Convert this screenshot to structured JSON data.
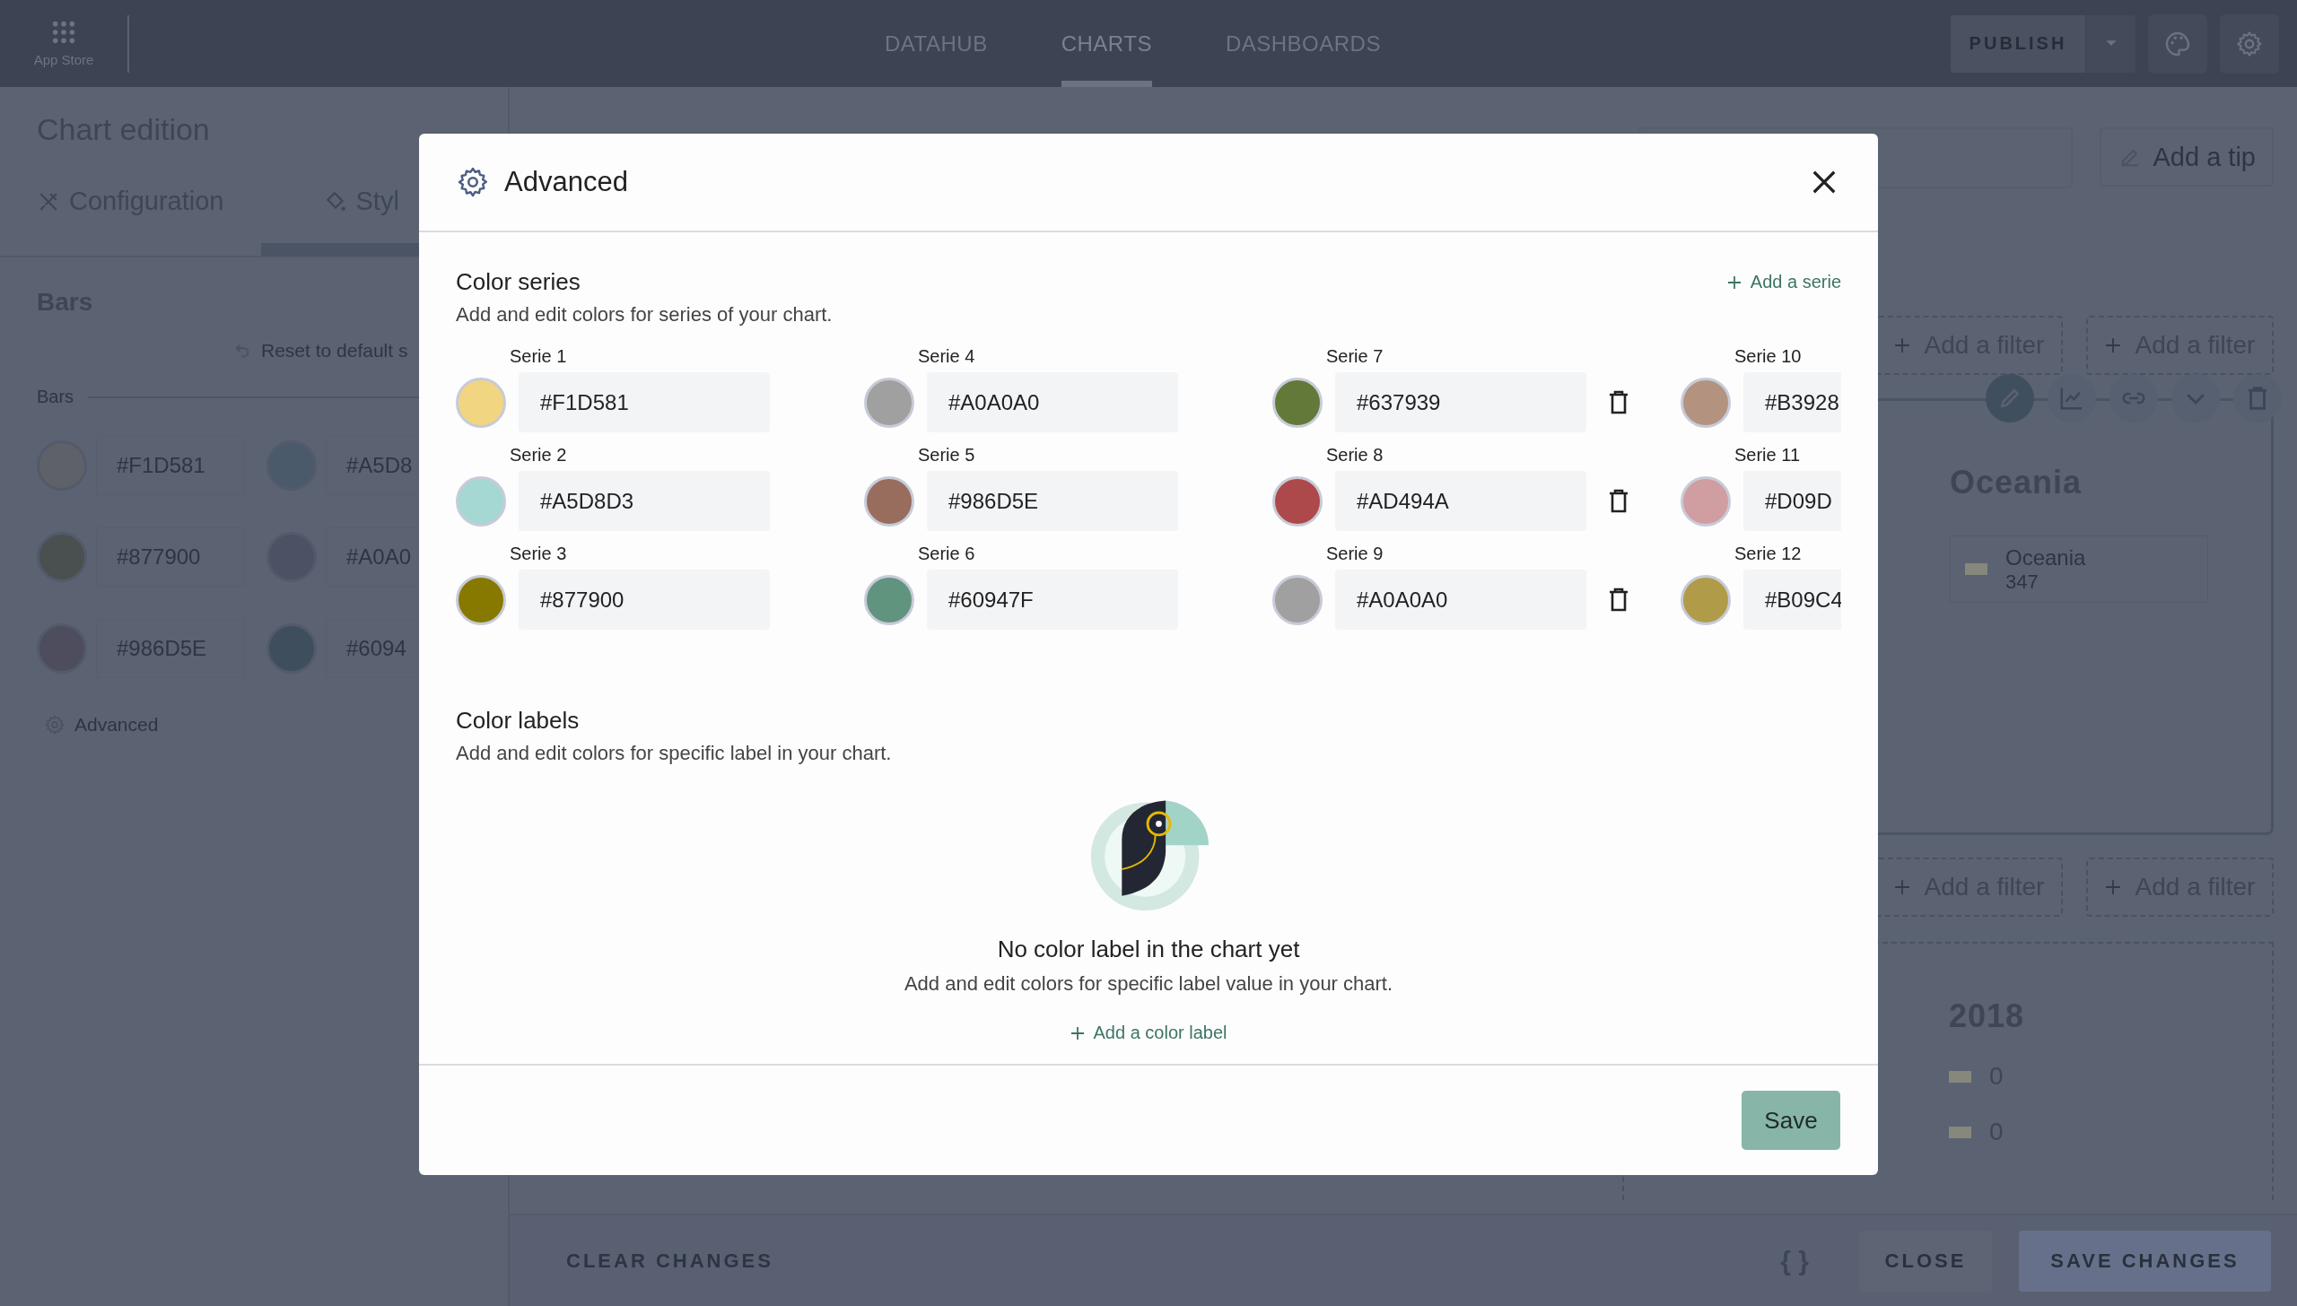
{
  "top_bar": {
    "app_store_label": "App Store",
    "nav": [
      {
        "label": "DATAHUB",
        "selected": false
      },
      {
        "label": "CHARTS",
        "selected": true
      },
      {
        "label": "DASHBOARDS",
        "selected": false
      }
    ],
    "publish_button": "PUBLISH"
  },
  "left_panel": {
    "title": "Chart edition",
    "tabs": [
      {
        "label": "Configuration",
        "kind": "tools",
        "selected": false
      },
      {
        "label": "Styl",
        "kind": "style",
        "selected": true
      }
    ],
    "section_title": "Bars",
    "reset_link": "Reset to default s",
    "group_label": "Bars",
    "colors": [
      {
        "hex": "#F1D581",
        "color": "#5f6168"
      },
      {
        "hex": "#A5D8",
        "color": "#4b5a6a"
      },
      {
        "hex": "#877900",
        "color": "#4a504f"
      },
      {
        "hex": "#A0A0",
        "color": "#4c5263"
      },
      {
        "hex": "#986D5E",
        "color": "#4d4d5d"
      },
      {
        "hex": "#6094",
        "color": "#3f4e5c"
      }
    ],
    "advanced_link": "Advanced"
  },
  "main": {
    "add_tip_button": "Add a tip",
    "filters_top": [
      "Add a filter",
      "Add a filter"
    ],
    "toolbar": [
      {
        "kind": "pencil",
        "selected": true
      },
      {
        "kind": "chart",
        "selected": false
      },
      {
        "kind": "link",
        "selected": false
      },
      {
        "kind": "chevron",
        "selected": false
      },
      {
        "kind": "trash",
        "selected": false
      }
    ],
    "chart_card": {
      "title": "Oceania",
      "legend": [
        {
          "label": "Oceania",
          "value": "347"
        }
      ]
    },
    "filters_bottom": [
      "Add a filter",
      "Add a filter"
    ],
    "second_card": {
      "title": "2018",
      "legend": [
        "0",
        "0"
      ]
    }
  },
  "bottom_bar": {
    "clear_button": "CLEAR CHANGES",
    "code_button": "{ }",
    "close_button": "CLOSE",
    "save_button": "SAVE CHANGES"
  },
  "modal": {
    "title": "Advanced",
    "color_series": {
      "title": "Color series",
      "subtitle": "Add and edit colors for series of your chart.",
      "add_button": "Add a serie",
      "series": [
        {
          "label": "Serie 1",
          "hex": "#F1D581",
          "color": "#f1d581",
          "deletable": false
        },
        {
          "label": "Serie 2",
          "hex": "#A5D8D3",
          "color": "#a5d8d3",
          "deletable": false
        },
        {
          "label": "Serie 3",
          "hex": "#877900",
          "color": "#877900",
          "deletable": false
        },
        {
          "label": "Serie 4",
          "hex": "#A0A0A0",
          "color": "#a0a0a0",
          "deletable": false
        },
        {
          "label": "Serie 5",
          "hex": "#986D5E",
          "color": "#986d5e",
          "deletable": false
        },
        {
          "label": "Serie 6",
          "hex": "#60947F",
          "color": "#60947f",
          "deletable": false
        },
        {
          "label": "Serie 7",
          "hex": "#637939",
          "color": "#637939",
          "deletable": true
        },
        {
          "label": "Serie 8",
          "hex": "#AD494A",
          "color": "#ad494a",
          "deletable": true
        },
        {
          "label": "Serie 9",
          "hex": "#A0A0A0",
          "color": "#a0a0a0",
          "deletable": true
        },
        {
          "label": "Serie 10",
          "hex": "#B3928",
          "color": "#b39280",
          "deletable": false
        },
        {
          "label": "Serie 11",
          "hex": "#D09D",
          "color": "#d09da0",
          "deletable": false
        },
        {
          "label": "Serie 12",
          "hex": "#B09C4",
          "color": "#b09c48",
          "deletable": false
        }
      ]
    },
    "color_labels": {
      "title": "Color labels",
      "subtitle": "Add and edit colors for specific label in your chart.",
      "empty_title": "No color label in the chart yet",
      "empty_text": "Add and edit colors for specific label value in your chart.",
      "add_button": "Add a color label"
    },
    "save_button": "Save"
  }
}
